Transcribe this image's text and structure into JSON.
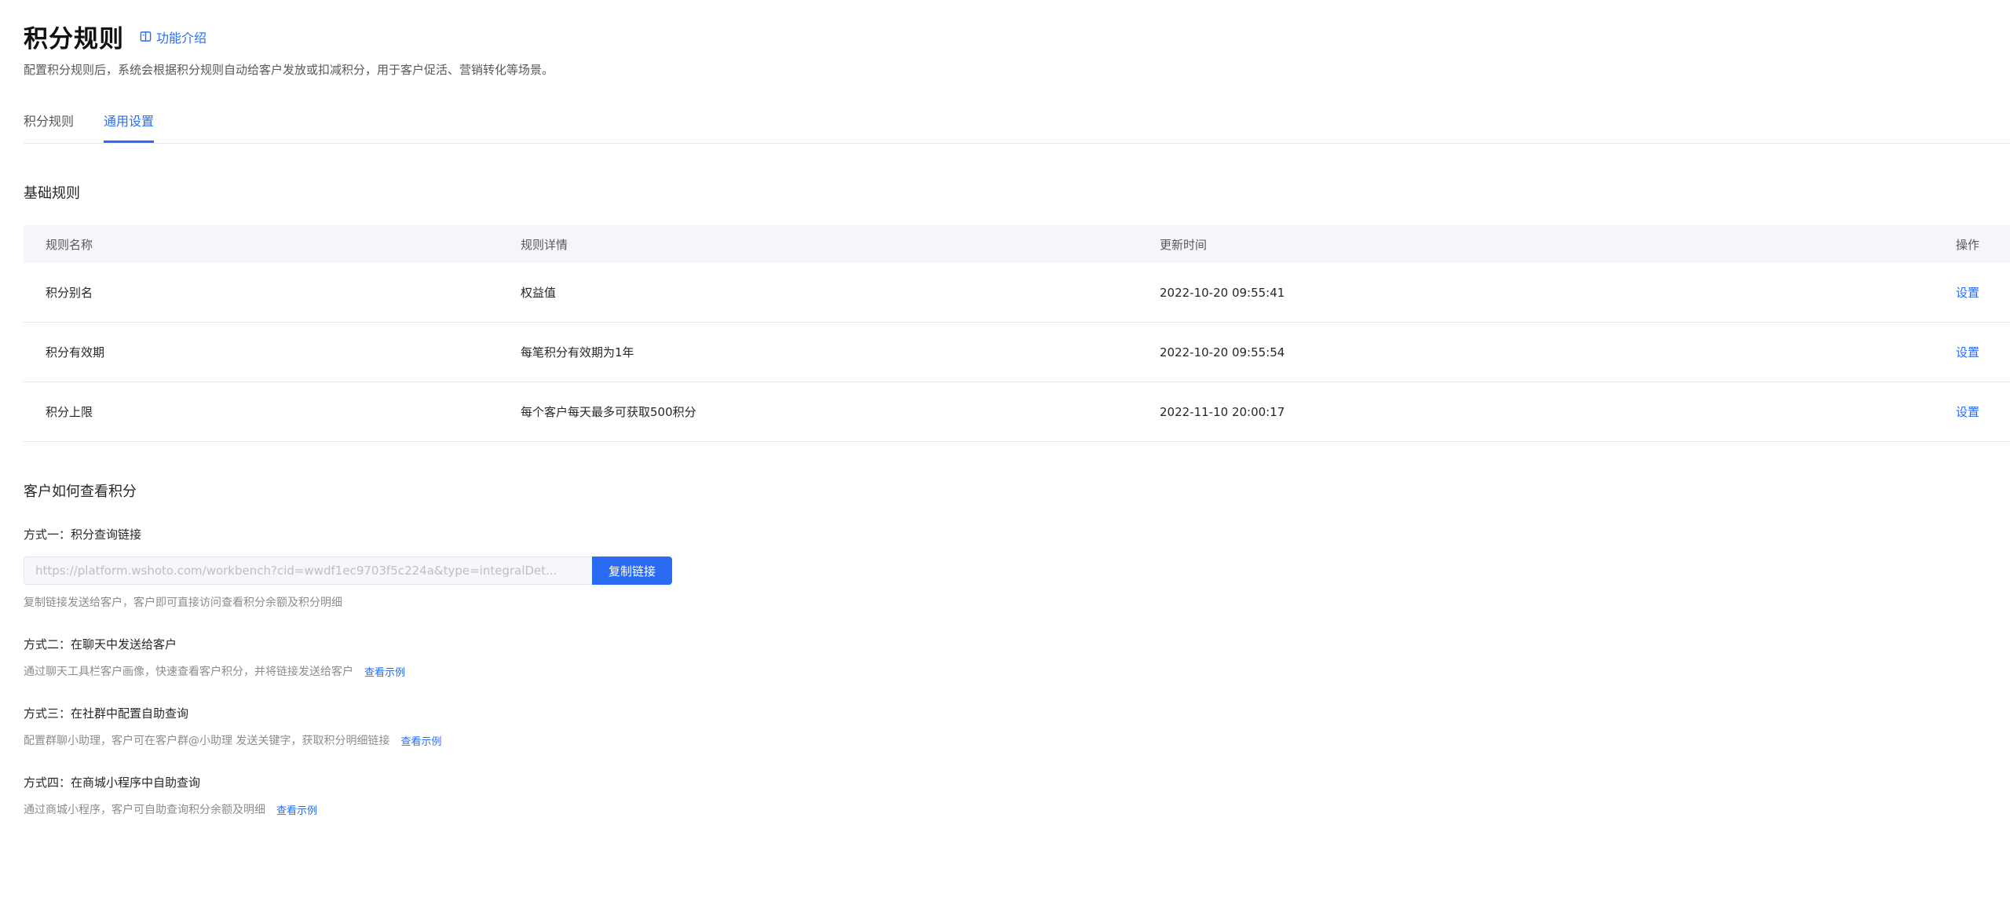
{
  "header": {
    "title": "积分规则",
    "intro_link": "功能介绍",
    "description": "配置积分规则后，系统会根据积分规则自动给客户发放或扣减积分，用于客户促活、营销转化等场景。"
  },
  "tabs": [
    {
      "label": "积分规则",
      "active": false
    },
    {
      "label": "通用设置",
      "active": true
    }
  ],
  "basic_rules": {
    "title": "基础规则",
    "columns": [
      "规则名称",
      "规则详情",
      "更新时间",
      "操作"
    ],
    "rows": [
      {
        "name": "积分别名",
        "detail": "权益值",
        "updated": "2022-10-20 09:55:41",
        "action": "设置"
      },
      {
        "name": "积分有效期",
        "detail": "每笔积分有效期为1年",
        "updated": "2022-10-20 09:55:54",
        "action": "设置"
      },
      {
        "name": "积分上限",
        "detail": "每个客户每天最多可获取500积分",
        "updated": "2022-11-10 20:00:17",
        "action": "设置"
      }
    ]
  },
  "view_points": {
    "title": "客户如何查看积分",
    "method1": {
      "label": "方式一：积分查询链接",
      "link_value": "https://platform.wshoto.com/workbench?cid=wwdf1ec9703f5c224a&type=integralDet...",
      "copy_button": "复制链接",
      "desc": "复制链接发送给客户，客户即可直接访问查看积分余额及积分明细"
    },
    "method2": {
      "label": "方式二：在聊天中发送给客户",
      "desc": "通过聊天工具栏客户画像，快速查看客户积分，并将链接发送给客户",
      "example": "查看示例"
    },
    "method3": {
      "label": "方式三：在社群中配置自助查询",
      "desc": "配置群聊小助理，客户可在客户群@小助理 发送关键字，获取积分明细链接",
      "example": "查看示例"
    },
    "method4": {
      "label": "方式四：在商城小程序中自助查询",
      "desc": "通过商城小程序，客户可自助查询积分余额及明细",
      "example": "查看示例"
    }
  },
  "colors": {
    "accent": "#2b6bf3",
    "table_header_bg": "#f4f6f9"
  },
  "icons": {
    "intro": "book-icon"
  }
}
